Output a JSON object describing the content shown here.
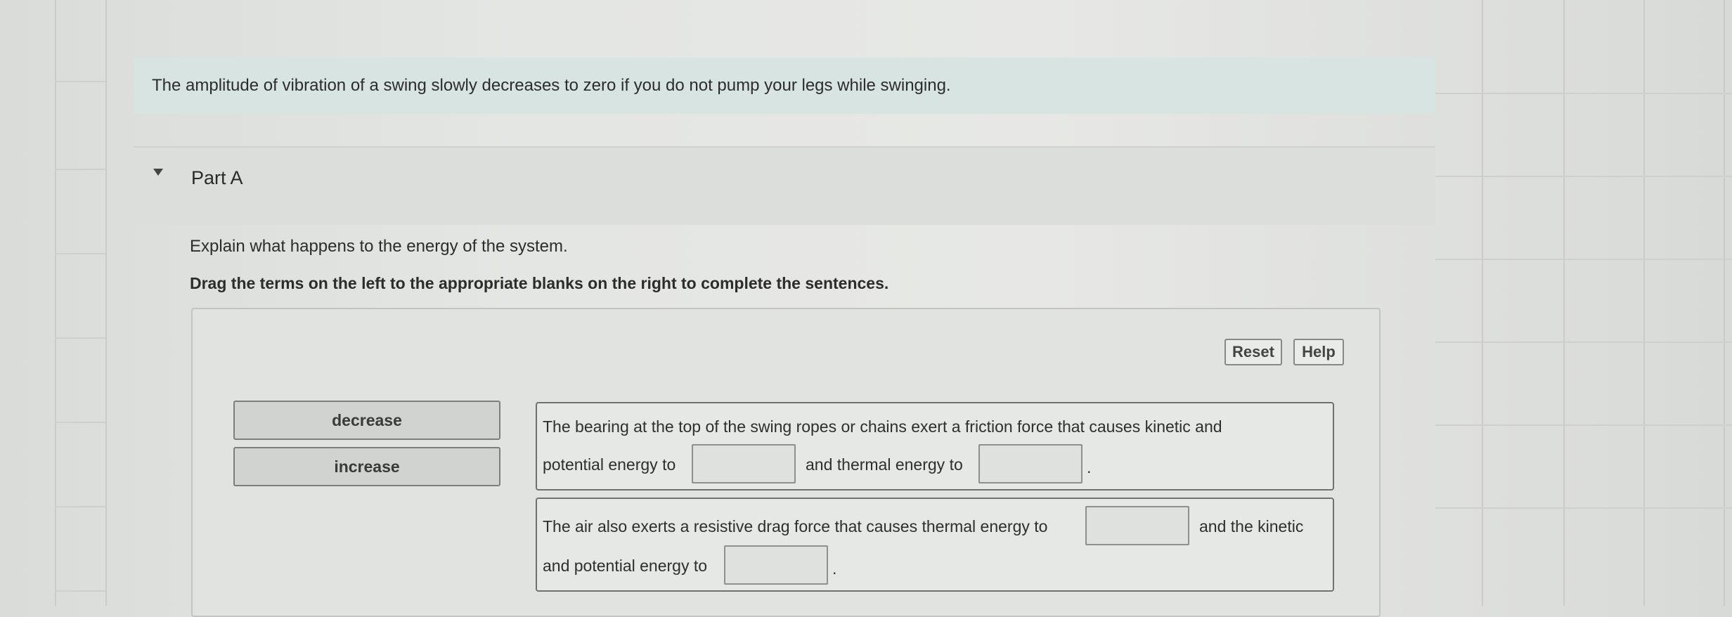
{
  "intro": {
    "text": "The amplitude of vibration of a swing slowly decreases to zero if you do not pump your legs while swinging."
  },
  "part": {
    "title": "Part A",
    "question": "Explain what happens to the energy of the system.",
    "instruction": "Drag the terms on the left to the appropriate blanks on the right to complete the sentences."
  },
  "toolbar": {
    "reset_label": "Reset",
    "help_label": "Help"
  },
  "terms": [
    "decrease",
    "increase"
  ],
  "sentences": [
    {
      "line1": "The bearing at the top of the swing ropes or chains exert a friction force that causes kinetic and",
      "seg1": "potential energy to",
      "seg2": "and thermal energy to",
      "end": "."
    },
    {
      "seg1": "The air also exerts a resistive drag force that causes thermal energy to",
      "seg2": "and the kinetic",
      "seg3": "and potential energy to",
      "end": "."
    }
  ],
  "colors": {
    "intro_bg": "#d8e4e1",
    "panel_bg": "#e1e3e0",
    "term_bg": "#d1d3d0"
  }
}
